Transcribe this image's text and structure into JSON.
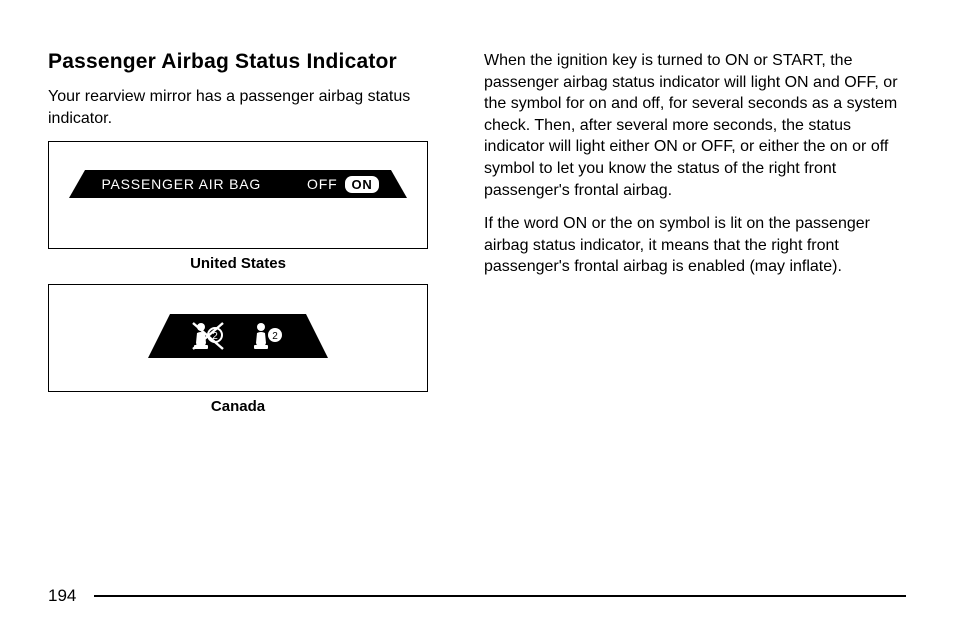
{
  "heading": "Passenger Airbag Status Indicator",
  "intro": "Your rearview mirror has a passenger airbag status indicator.",
  "figure_us": {
    "label_main": "PASSENGER AIR BAG",
    "label_off": "OFF",
    "label_on": "ON",
    "caption": "United States"
  },
  "figure_ca": {
    "caption": "Canada"
  },
  "right_para_1": "When the ignition key is turned to ON or START, the passenger airbag status indicator will light ON and OFF, or the symbol for on and off, for several seconds as a system check. Then, after several more seconds, the status indicator will light either ON or OFF, or either the on or off symbol to let you know the status of the right front passenger's frontal airbag.",
  "right_para_2": "If the word ON or the on symbol is lit on the passenger airbag status indicator, it means that the right front passenger's frontal airbag is enabled (may inflate).",
  "page_number": "194"
}
